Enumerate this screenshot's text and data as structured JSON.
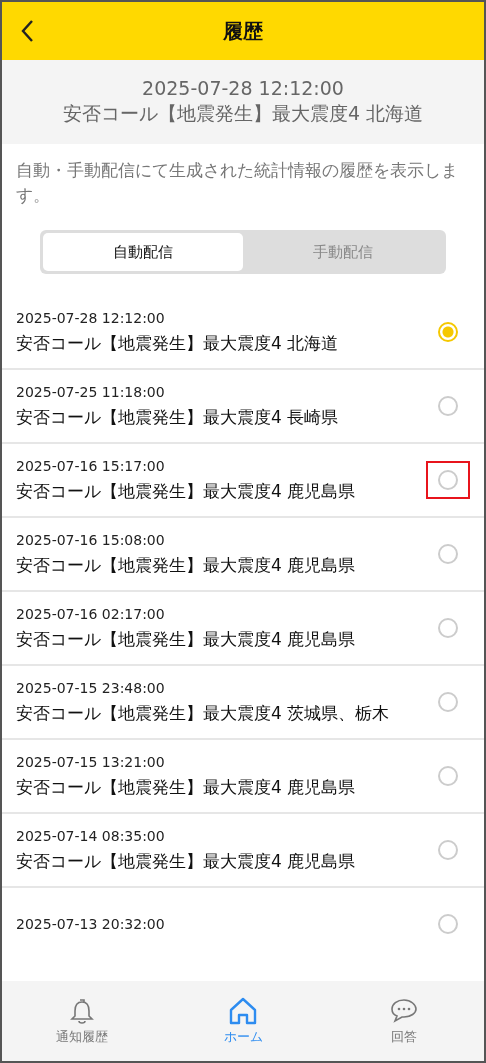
{
  "header": {
    "title": "履歴"
  },
  "summary": {
    "datetime": "2025-07-28 12:12:00",
    "title": "安否コール【地震発生】最大震度4 北海道"
  },
  "description": "自動・手動配信にて生成された統計情報の履歴を表示します。",
  "segments": [
    {
      "label": "自動配信",
      "selected": true
    },
    {
      "label": "手動配信",
      "selected": false
    }
  ],
  "history": [
    {
      "datetime": "2025-07-28 12:12:00",
      "title": "安否コール【地震発生】最大震度4 北海道",
      "selected": true,
      "highlighted": false
    },
    {
      "datetime": "2025-07-25 11:18:00",
      "title": "安否コール【地震発生】最大震度4 長崎県",
      "selected": false,
      "highlighted": false
    },
    {
      "datetime": "2025-07-16 15:17:00",
      "title": "安否コール【地震発生】最大震度4 鹿児島県",
      "selected": false,
      "highlighted": true
    },
    {
      "datetime": "2025-07-16 15:08:00",
      "title": "安否コール【地震発生】最大震度4 鹿児島県",
      "selected": false,
      "highlighted": false
    },
    {
      "datetime": "2025-07-16 02:17:00",
      "title": "安否コール【地震発生】最大震度4 鹿児島県",
      "selected": false,
      "highlighted": false
    },
    {
      "datetime": "2025-07-15 23:48:00",
      "title": "安否コール【地震発生】最大震度4 茨城県、栃木",
      "selected": false,
      "highlighted": false
    },
    {
      "datetime": "2025-07-15 13:21:00",
      "title": "安否コール【地震発生】最大震度4 鹿児島県",
      "selected": false,
      "highlighted": false
    },
    {
      "datetime": "2025-07-14 08:35:00",
      "title": "安否コール【地震発生】最大震度4 鹿児島県",
      "selected": false,
      "highlighted": false
    },
    {
      "datetime": "2025-07-13 20:32:00",
      "selected": false,
      "highlighted": false
    }
  ],
  "bottom_nav": [
    {
      "kind": "bell",
      "label": "通知履歴",
      "selected": false
    },
    {
      "kind": "home",
      "label": "ホーム",
      "selected": true
    },
    {
      "kind": "chat",
      "label": "回答",
      "selected": false
    }
  ]
}
